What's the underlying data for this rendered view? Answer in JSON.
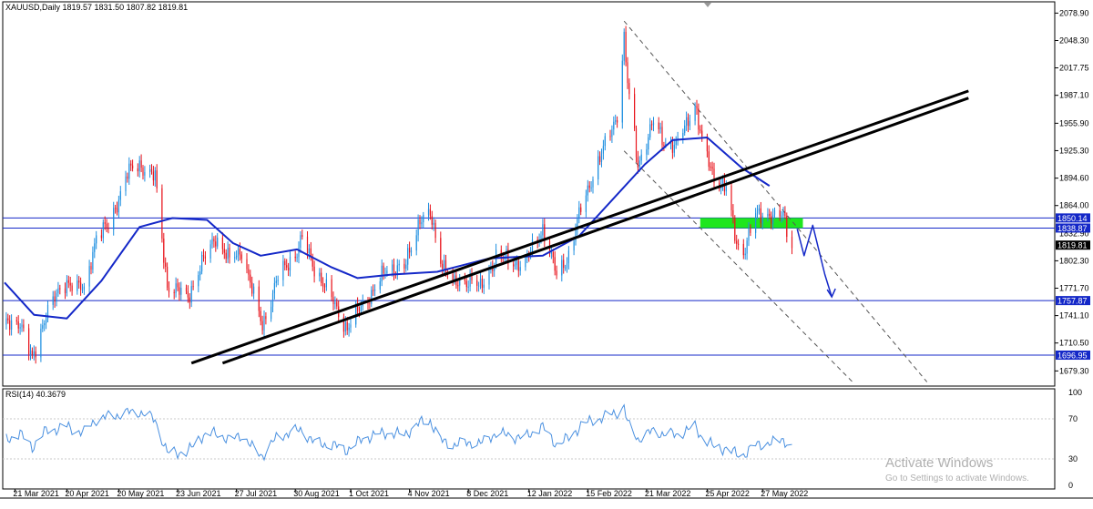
{
  "header": {
    "symbol_line": "XAUUSD,Daily  1819.57 1831.50 1807.82 1819.81",
    "rsi_label": "RSI(14) 40.3679"
  },
  "watermark": {
    "line1": "Activate Windows",
    "line2": "Go to Settings to activate Windows."
  },
  "colors": {
    "bull": "#1e8fe0",
    "bear": "#e8141c",
    "ma": "#1428c8",
    "hline": "#1428c8",
    "trend": "#000000",
    "zone": "#1ee61e",
    "rsi": "#4a90e0",
    "channel": "#555555"
  },
  "chart_data": {
    "type": "line",
    "price_axis": {
      "ticks": [
        "2078.90",
        "2048.30",
        "2017.75",
        "1987.10",
        "1955.90",
        "1925.30",
        "1894.60",
        "1864.00",
        "1802.30",
        "1771.70",
        "1741.10",
        "1710.50",
        "1679.30"
      ],
      "ylim": [
        1665,
        2090
      ]
    },
    "x_axis": {
      "tick_labels": [
        "21 Mar 2021",
        "20 Apr 2021",
        "20 May 2021",
        "23 Jun 2021",
        "27 Jul 2021",
        "30 Aug 2021",
        "1 Oct 2021",
        "4 Nov 2021",
        "8 Dec 2021",
        "12 Jan 2022",
        "15 Feb 2022",
        "21 Mar 2022",
        "25 Apr 2022",
        "27 May 2022"
      ]
    },
    "horizontal_levels": [
      {
        "value": 1850.14,
        "label": "1850.14"
      },
      {
        "value": 1838.87,
        "label": "1838.87"
      },
      {
        "value": 1757.87,
        "label": "1757.87"
      },
      {
        "value": 1696.95,
        "label": "1696.95"
      }
    ],
    "current_price": {
      "value": 1819.81,
      "label": "1819.81"
    },
    "hidden_price_label": "1832.90",
    "close_path": [
      [
        "2021-03-16",
        1731
      ],
      [
        "2021-03-24",
        1735
      ],
      [
        "2021-03-31",
        1690
      ],
      [
        "2021-04-08",
        1745
      ],
      [
        "2021-04-20",
        1780
      ],
      [
        "2021-04-30",
        1768
      ],
      [
        "2021-05-07",
        1831
      ],
      [
        "2021-05-14",
        1840
      ],
      [
        "2021-05-25",
        1900
      ],
      [
        "2021-06-01",
        1910
      ],
      [
        "2021-06-10",
        1895
      ],
      [
        "2021-06-17",
        1775
      ],
      [
        "2021-06-29",
        1762
      ],
      [
        "2021-07-06",
        1795
      ],
      [
        "2021-07-15",
        1830
      ],
      [
        "2021-07-23",
        1802
      ],
      [
        "2021-07-30",
        1815
      ],
      [
        "2021-08-06",
        1762
      ],
      [
        "2021-08-11",
        1730
      ],
      [
        "2021-08-20",
        1784
      ],
      [
        "2021-08-31",
        1813
      ],
      [
        "2021-09-03",
        1827
      ],
      [
        "2021-09-10",
        1795
      ],
      [
        "2021-09-20",
        1760
      ],
      [
        "2021-09-29",
        1726
      ],
      [
        "2021-10-08",
        1755
      ],
      [
        "2021-10-15",
        1770
      ],
      [
        "2021-10-22",
        1795
      ],
      [
        "2021-11-01",
        1793
      ],
      [
        "2021-11-10",
        1850
      ],
      [
        "2021-11-16",
        1852
      ],
      [
        "2021-11-22",
        1805
      ],
      [
        "2021-11-30",
        1775
      ],
      [
        "2021-12-10",
        1783
      ],
      [
        "2021-12-15",
        1770
      ],
      [
        "2021-12-24",
        1808
      ],
      [
        "2022-01-03",
        1800
      ],
      [
        "2022-01-10",
        1800
      ],
      [
        "2022-01-20",
        1839
      ],
      [
        "2022-01-28",
        1786
      ],
      [
        "2022-02-04",
        1808
      ],
      [
        "2022-02-11",
        1860
      ],
      [
        "2022-02-18",
        1898
      ],
      [
        "2022-02-24",
        1926
      ],
      [
        "2022-03-04",
        1966
      ],
      [
        "2022-03-08",
        2050
      ],
      [
        "2022-03-10",
        2000
      ],
      [
        "2022-03-16",
        1910
      ],
      [
        "2022-03-25",
        1957
      ],
      [
        "2022-03-31",
        1936
      ],
      [
        "2022-04-07",
        1930
      ],
      [
        "2022-04-18",
        1978
      ],
      [
        "2022-04-22",
        1934
      ],
      [
        "2022-04-29",
        1896
      ],
      [
        "2022-05-06",
        1883
      ],
      [
        "2022-05-12",
        1822
      ],
      [
        "2022-05-16",
        1813
      ],
      [
        "2022-05-23",
        1853
      ],
      [
        "2022-05-30",
        1855
      ],
      [
        "2022-06-03",
        1850
      ],
      [
        "2022-06-08",
        1853
      ],
      [
        "2022-06-13",
        1819.81
      ]
    ],
    "moving_average": [
      [
        "2021-03-15",
        1778
      ],
      [
        "2021-04-01",
        1742
      ],
      [
        "2021-04-20",
        1738
      ],
      [
        "2021-05-10",
        1780
      ],
      [
        "2021-06-01",
        1840
      ],
      [
        "2021-06-20",
        1850
      ],
      [
        "2021-07-10",
        1848
      ],
      [
        "2021-07-25",
        1822
      ],
      [
        "2021-08-10",
        1808
      ],
      [
        "2021-08-31",
        1815
      ],
      [
        "2021-09-20",
        1795
      ],
      [
        "2021-10-05",
        1783
      ],
      [
        "2021-10-25",
        1787
      ],
      [
        "2021-11-20",
        1790
      ],
      [
        "2021-12-20",
        1805
      ],
      [
        "2022-01-20",
        1808
      ],
      [
        "2022-02-10",
        1830
      ],
      [
        "2022-03-01",
        1870
      ],
      [
        "2022-03-20",
        1910
      ],
      [
        "2022-04-05",
        1937
      ],
      [
        "2022-04-25",
        1940
      ],
      [
        "2022-05-15",
        1906
      ],
      [
        "2022-05-31",
        1886
      ]
    ],
    "trendlines": [
      {
        "from": [
          "2021-07-01",
          1688
        ],
        "to": [
          "2022-09-23",
          1992
        ]
      },
      {
        "from": [
          "2021-07-19",
          1688
        ],
        "to": [
          "2022-09-23",
          1984
        ]
      }
    ],
    "channel": [
      {
        "from": [
          "2022-03-08",
          2070
        ],
        "to": [
          "2022-08-30",
          1667
        ]
      },
      {
        "from": [
          "2022-03-08",
          1925
        ],
        "to": [
          "2022-07-18",
          1667
        ]
      }
    ],
    "zone": {
      "from": "2022-04-21",
      "to": "2022-06-13",
      "low": 1838.87,
      "high": 1850.14
    },
    "projection": [
      [
        "2022-06-16",
        1838
      ],
      [
        "2022-06-20",
        1808
      ],
      [
        "2022-06-25",
        1842
      ],
      [
        "2022-07-02",
        1787
      ],
      [
        "2022-07-06",
        1762
      ]
    ],
    "rsi": {
      "label": "RSI(14)",
      "value": 40.3679,
      "levels": [
        100,
        70,
        30,
        0
      ],
      "series": [
        [
          "2021-03-16",
          49
        ],
        [
          "2021-03-24",
          55
        ],
        [
          "2021-03-31",
          42
        ],
        [
          "2021-04-08",
          58
        ],
        [
          "2021-04-20",
          62
        ],
        [
          "2021-04-30",
          56
        ],
        [
          "2021-05-07",
          70
        ],
        [
          "2021-05-14",
          72
        ],
        [
          "2021-05-25",
          76
        ],
        [
          "2021-06-01",
          77
        ],
        [
          "2021-06-10",
          69
        ],
        [
          "2021-06-17",
          36
        ],
        [
          "2021-06-29",
          37
        ],
        [
          "2021-07-06",
          52
        ],
        [
          "2021-07-15",
          56
        ],
        [
          "2021-07-23",
          49
        ],
        [
          "2021-07-30",
          54
        ],
        [
          "2021-08-06",
          40
        ],
        [
          "2021-08-11",
          33
        ],
        [
          "2021-08-20",
          53
        ],
        [
          "2021-08-31",
          58
        ],
        [
          "2021-09-03",
          59
        ],
        [
          "2021-09-10",
          46
        ],
        [
          "2021-09-20",
          44
        ],
        [
          "2021-09-29",
          39
        ],
        [
          "2021-10-08",
          50
        ],
        [
          "2021-10-15",
          54
        ],
        [
          "2021-10-22",
          56
        ],
        [
          "2021-11-01",
          54
        ],
        [
          "2021-11-10",
          66
        ],
        [
          "2021-11-16",
          68
        ],
        [
          "2021-11-22",
          48
        ],
        [
          "2021-11-30",
          44
        ],
        [
          "2021-12-10",
          47
        ],
        [
          "2021-12-15",
          45
        ],
        [
          "2021-12-24",
          56
        ],
        [
          "2022-01-03",
          52
        ],
        [
          "2022-01-10",
          52
        ],
        [
          "2022-01-20",
          62
        ],
        [
          "2022-01-28",
          44
        ],
        [
          "2022-02-04",
          51
        ],
        [
          "2022-02-11",
          63
        ],
        [
          "2022-02-18",
          69
        ],
        [
          "2022-02-24",
          71
        ],
        [
          "2022-03-04",
          77
        ],
        [
          "2022-03-08",
          82
        ],
        [
          "2022-03-10",
          65
        ],
        [
          "2022-03-16",
          50
        ],
        [
          "2022-03-25",
          58
        ],
        [
          "2022-03-31",
          55
        ],
        [
          "2022-04-07",
          54
        ],
        [
          "2022-04-18",
          62
        ],
        [
          "2022-04-22",
          52
        ],
        [
          "2022-04-29",
          42
        ],
        [
          "2022-05-06",
          40
        ],
        [
          "2022-05-12",
          35
        ],
        [
          "2022-05-16",
          34
        ],
        [
          "2022-05-23",
          44
        ],
        [
          "2022-05-30",
          45
        ],
        [
          "2022-06-03",
          47
        ],
        [
          "2022-06-08",
          50
        ],
        [
          "2022-06-13",
          40.3679
        ]
      ]
    }
  }
}
